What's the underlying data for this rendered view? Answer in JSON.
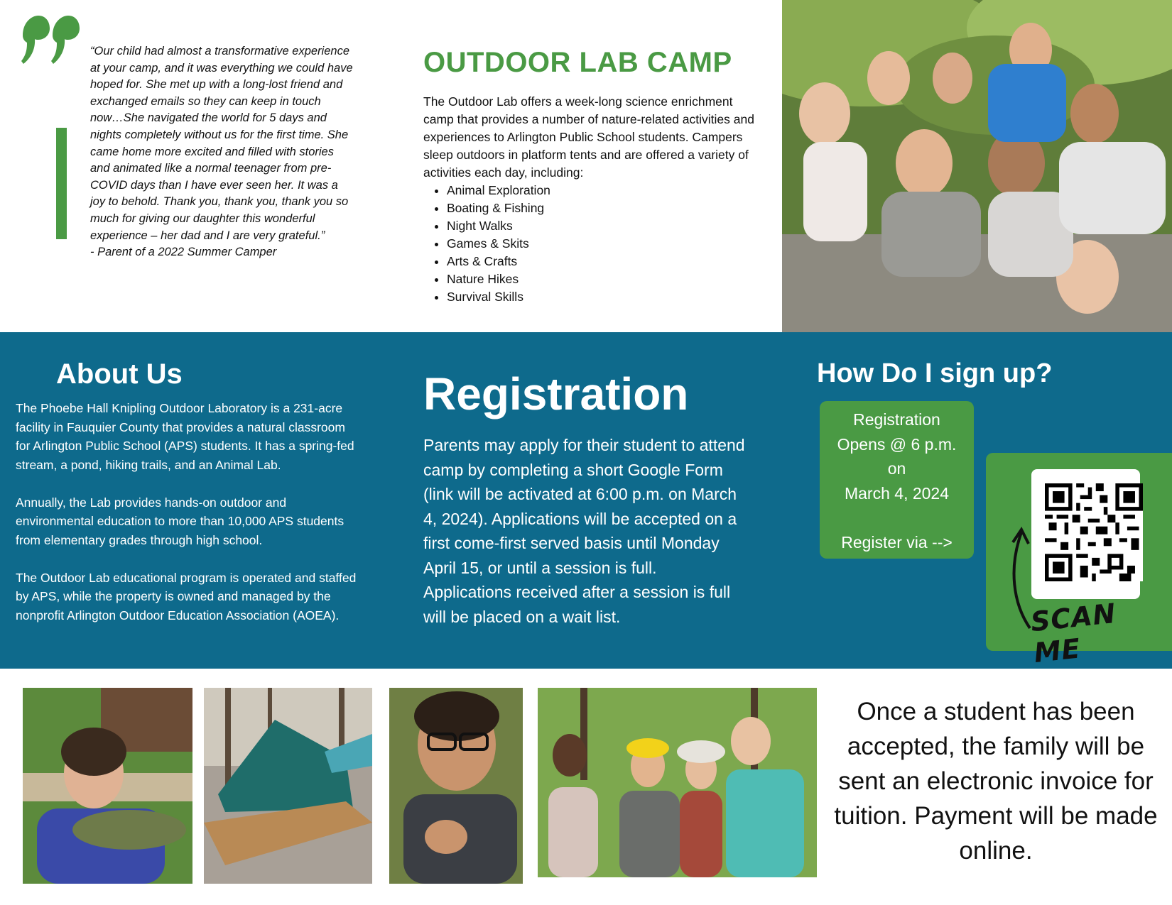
{
  "testimonial": {
    "quote": "“Our child had almost a transformative experience at your camp, and it was everything we could have hoped for. She met up with a long-lost friend and exchanged emails so they can keep in touch now…She navigated the world for 5 days and nights completely without us for the first time. She came home more excited and filled with stories and animated like a normal teenager from pre-COVID days than I have ever seen her. It was a joy to behold. Thank you, thank you, thank you so much for giving our daughter this wonderful experience – her dad and I are very grateful.”",
    "attribution": "- Parent of a 2022 Summer Camper"
  },
  "camp": {
    "title": "OUTDOOR LAB CAMP",
    "intro": "The Outdoor Lab offers a week-long science enrichment camp that provides a number of nature-related activities and experiences to Arlington Public School students. Campers sleep outdoors in platform tents and are offered a variety of activities each day, including:",
    "activities": [
      "Animal Exploration",
      "Boating & Fishing",
      "Night Walks",
      "Games & Skits",
      "Arts & Crafts",
      "Nature Hikes",
      "Survival Skills"
    ]
  },
  "about": {
    "title": "About Us",
    "paragraphs": [
      "The Phoebe Hall Knipling Outdoor Laboratory is a 231-acre facility in Fauquier County that provides a natural classroom for Arlington Public School (APS) students. It has a spring-fed stream, a pond, hiking trails, and an Animal Lab.",
      "Annually, the Lab provides hands-on outdoor and environmental education to more than 10,000 APS students from elementary grades through high school.",
      "The Outdoor Lab educational program is operated and staffed by APS, while the property is owned and managed by the nonprofit Arlington Outdoor Education Association (AOEA)."
    ]
  },
  "registration": {
    "title": "Registration",
    "body": "Parents may apply for their student to attend camp by completing a short Google Form (link will be activated at 6:00 p.m. on March 4, 2024). Applications will be accepted on a first come-first served basis until Monday April 15, or until a session is full. Applications received after a session is full will be placed on a wait list."
  },
  "signup": {
    "title": "How Do I sign up?",
    "box_lines": [
      "Registration",
      "Opens @ 6 p.m.",
      "on",
      "March 4, 2024",
      "",
      "Register via -->"
    ],
    "scan_label": "SCAN ME"
  },
  "invoice_note": "Once a student has been accepted, the family will be sent an electronic invoice for tuition. Payment will be made online.",
  "colors": {
    "green": "#4a9a44",
    "blue_band": "#0e6a8c",
    "white": "#ffffff"
  },
  "icons": [
    "quote-mark-icon",
    "qr-code-icon",
    "curved-arrow-icon"
  ]
}
